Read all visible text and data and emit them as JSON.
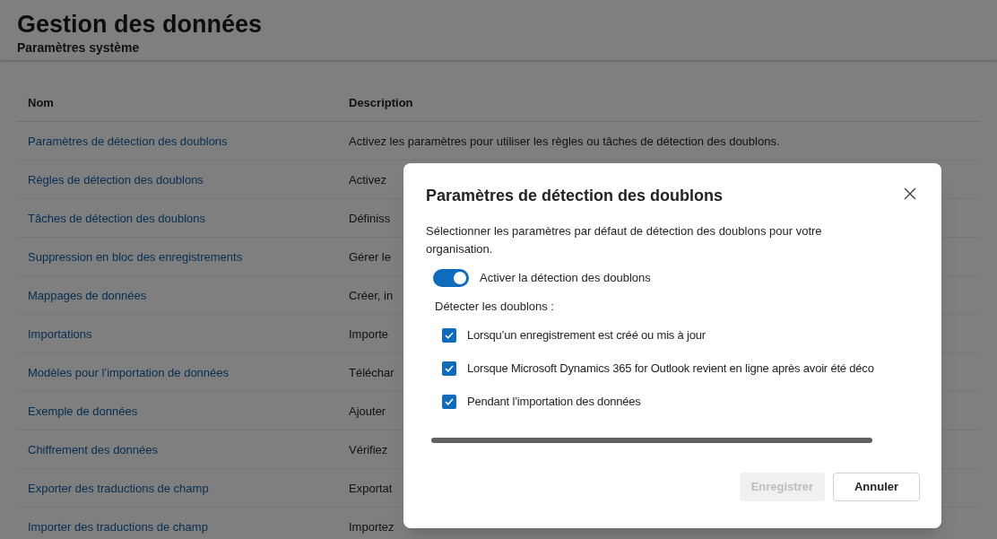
{
  "header": {
    "title": "Gestion des données",
    "subtitle": "Paramètres système"
  },
  "table": {
    "columns": [
      "Nom",
      "Description"
    ],
    "rows": [
      {
        "name": "Paramètres de détection des doublons",
        "description": "Activez les paramètres pour utiliser les règles ou tâches de détection des doublons."
      },
      {
        "name": "Règles de détection des doublons",
        "description": "Activez"
      },
      {
        "name": "Tâches de détection des doublons",
        "description": "Définiss"
      },
      {
        "name": "Suppression en bloc des enregistrements",
        "description": "Gérer le"
      },
      {
        "name": "Mappages de données",
        "description": "Créer, in"
      },
      {
        "name": "Importations",
        "description": "Importe"
      },
      {
        "name": "Modèles pour l’importation de données",
        "description": "Téléchar"
      },
      {
        "name": "Exemple de données",
        "description": "Ajouter"
      },
      {
        "name": "Chiffrement des données",
        "description": "Vérifiez"
      },
      {
        "name": "Exporter des traductions de champ",
        "description": "Exportat"
      },
      {
        "name": "Importer des traductions de champ",
        "description": "Importez"
      }
    ]
  },
  "dialog": {
    "title": "Paramètres de détection des doublons",
    "description": "Sélectionner les paramètres par défaut de détection des doublons pour votre organisation.",
    "toggle": {
      "label": "Activer la détection des doublons",
      "on": true
    },
    "group_label": "Détecter les doublons :",
    "checkboxes": [
      {
        "label": "Lorsqu’un enregistrement est créé ou mis à jour",
        "checked": true
      },
      {
        "label": "Lorsque Microsoft Dynamics 365 for Outlook revient en ligne après avoir été déco",
        "checked": true
      },
      {
        "label": "Pendant l’importation des données",
        "checked": true
      }
    ],
    "buttons": [
      {
        "label": "Enregistrer",
        "disabled": true
      },
      {
        "label": "Annuler",
        "disabled": false
      }
    ]
  }
}
